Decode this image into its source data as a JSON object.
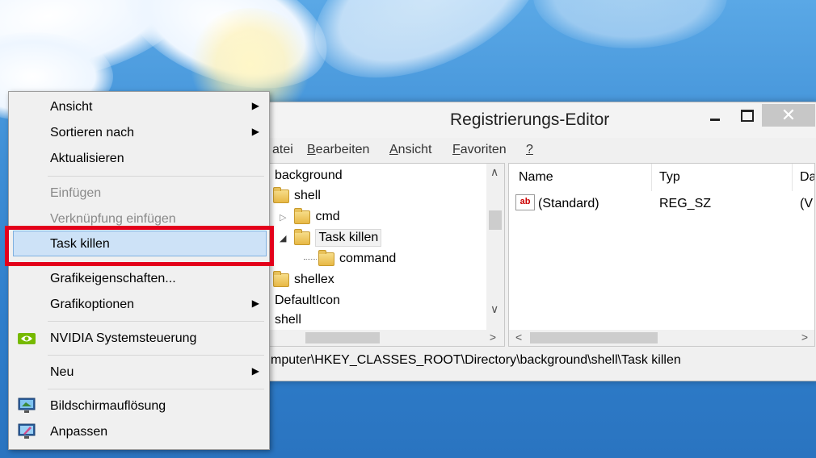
{
  "registry_window": {
    "title": "Registrierungs-Editor",
    "close_glyph": "✕",
    "menu": [
      {
        "label": "Datei",
        "visible": "atei"
      },
      {
        "label": "Bearbeiten",
        "accel": "B",
        "rest": "earbeiten"
      },
      {
        "label": "Ansicht",
        "accel": "A",
        "rest": "nsicht"
      },
      {
        "label": "Favoriten",
        "accel": "F",
        "rest": "avoriten"
      },
      {
        "label": "?",
        "accel": "?",
        "rest": ""
      }
    ],
    "tree": {
      "background": "background",
      "shell": "shell",
      "cmd": "cmd",
      "task_killen": "Task killen",
      "command": "command",
      "shellex": "shellex",
      "defaulticon": "DefaultIcon",
      "shell2": "shell"
    },
    "columns": [
      "Name",
      "Typ",
      "Da"
    ],
    "values": [
      {
        "icon": "ab",
        "name": "(Standard)",
        "type": "REG_SZ",
        "data": "(V"
      }
    ],
    "status_path": "mputer\\HKEY_CLASSES_ROOT\\Directory\\background\\shell\\Task killen"
  },
  "context_menu": {
    "items": {
      "ansicht": "Ansicht",
      "sortieren": "Sortieren nach",
      "aktualisieren": "Aktualisieren",
      "einfuegen": "Einfügen",
      "verknuepfung": "Verknüpfung einfügen",
      "task_killen": "Task killen",
      "grafikeigenschaften": "Grafikeigenschaften...",
      "grafikoptionen": "Grafikoptionen",
      "nvidia": "NVIDIA Systemsteuerung",
      "neu": "Neu",
      "bildschirm": "Bildschirmauflösung",
      "anpassen": "Anpassen"
    },
    "submenu_arrow": "▶",
    "highlight_color": "#cde2f7",
    "annotation_color": "#e3001b"
  }
}
